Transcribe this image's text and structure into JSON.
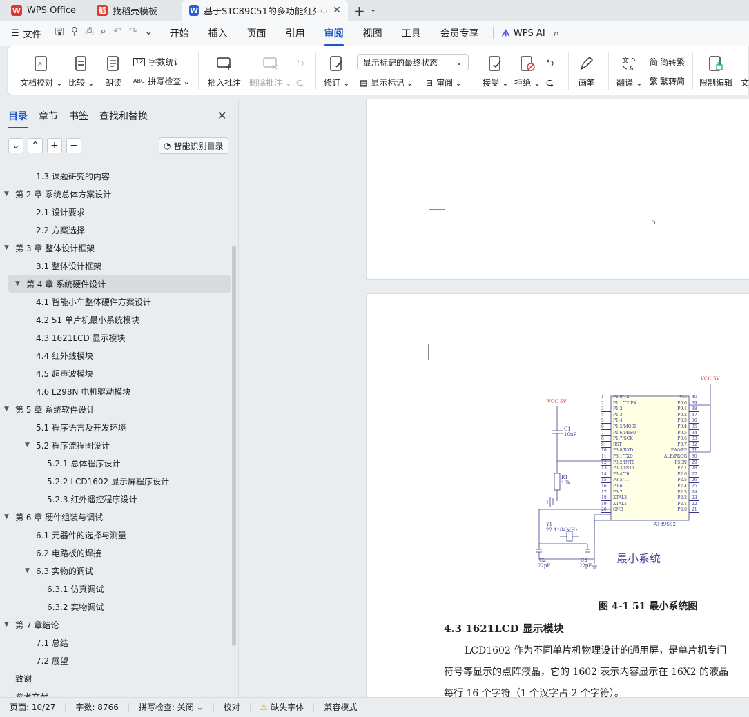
{
  "tabs": [
    {
      "label": "WPS Office",
      "color": "#e0362c"
    },
    {
      "label": "找稻壳模板",
      "color": "#e0362c"
    },
    {
      "label": "基于STC89C51的多功能红外遥",
      "color": "#2b5fd9"
    }
  ],
  "menu": {
    "file_label": "文件",
    "items": [
      "开始",
      "插入",
      "页面",
      "引用",
      "审阅",
      "视图",
      "工具",
      "会员专享"
    ],
    "active": "审阅",
    "wps_ai": "WPS AI"
  },
  "ribbon": {
    "doc_check": "文档校对",
    "compare": "比较",
    "read_aloud": "朗读",
    "word_count": "字数统计",
    "spell_check": "拼写检查",
    "insert_comment": "插入批注",
    "delete_comment": "删除批注",
    "track": "修订",
    "markup_state": "显示标记的最终状态",
    "show_markup": "显示标记",
    "review_pane": "审阅",
    "accept": "接受",
    "reject": "拒绝",
    "pen": "画笔",
    "translate": "翻译",
    "to_trad": "简转繁",
    "to_simp": "繁转简",
    "restrict": "限制编辑",
    "more": "文"
  },
  "sidebar": {
    "tabs": [
      "目录",
      "章节",
      "书签",
      "查找和替换"
    ],
    "smart_toc": "智能识别目录",
    "toc": [
      {
        "text": "1.3   课题研究的内容",
        "level": 2,
        "arrow": ""
      },
      {
        "text": "第 2 章  系统总体方案设计",
        "level": 1,
        "arrow": "▼"
      },
      {
        "text": "2.1  设计要求",
        "level": 2,
        "arrow": ""
      },
      {
        "text": "2.2  方案选择",
        "level": 2,
        "arrow": ""
      },
      {
        "text": "第 3 章  整体设计框架",
        "level": 1,
        "arrow": "▼"
      },
      {
        "text": "3.1  整体设计框架",
        "level": 2,
        "arrow": ""
      },
      {
        "text": "第 4 章  系统硬件设计",
        "level": 1,
        "arrow": "▼",
        "selected": true
      },
      {
        "text": "4.1  智能小车整体硬件方案设计",
        "level": 2,
        "arrow": ""
      },
      {
        "text": "4.2 51 单片机最小系统模块",
        "level": 2,
        "arrow": ""
      },
      {
        "text": "4.3 1621LCD 显示模块",
        "level": 2,
        "arrow": ""
      },
      {
        "text": "4.4  红外线模块",
        "level": 2,
        "arrow": ""
      },
      {
        "text": "4.5  超声波模块",
        "level": 2,
        "arrow": ""
      },
      {
        "text": "4.6 L298N 电机驱动模块",
        "level": 2,
        "arrow": ""
      },
      {
        "text": "第 5 章  系统软件设计",
        "level": 1,
        "arrow": "▼"
      },
      {
        "text": "5.1  程序语言及开发环境",
        "level": 2,
        "arrow": ""
      },
      {
        "text": "5.2  程序流程图设计",
        "level": 2,
        "arrow": "▼"
      },
      {
        "text": "5.2.1  总体程序设计",
        "level": 3,
        "arrow": ""
      },
      {
        "text": "5.2.2 LCD1602 显示屏程序设计",
        "level": 3,
        "arrow": ""
      },
      {
        "text": "5.2.3  红外遥控程序设计",
        "level": 3,
        "arrow": ""
      },
      {
        "text": "第 6 章  硬件组装与调试",
        "level": 1,
        "arrow": "▼"
      },
      {
        "text": "6.1  元器件的选择与测量",
        "level": 2,
        "arrow": ""
      },
      {
        "text": "6.2  电路板的焊接",
        "level": 2,
        "arrow": ""
      },
      {
        "text": "6.3  实物的调试",
        "level": 2,
        "arrow": "▼"
      },
      {
        "text": "6.3.1  仿真调试",
        "level": 3,
        "arrow": ""
      },
      {
        "text": "6.3.2  实物调试",
        "level": 3,
        "arrow": ""
      },
      {
        "text": "第 7 章结论",
        "level": 1,
        "arrow": "▼"
      },
      {
        "text": "7.1  总结",
        "level": 2,
        "arrow": ""
      },
      {
        "text": "7.2  展望",
        "level": 2,
        "arrow": ""
      },
      {
        "text": "致谢",
        "level": 1,
        "arrow": ""
      },
      {
        "text": "参考文献",
        "level": 1,
        "arrow": ""
      }
    ]
  },
  "document": {
    "page_number": "5",
    "schematic": {
      "vcc_top": "VCC 5V",
      "vcc_left": "VCC 5V",
      "c1": "C1",
      "c1_val": "10uF",
      "r1": "R1",
      "r1_val": "10k",
      "y1": "Y1",
      "y1_val": "22.1184MHz",
      "c2": "C2",
      "c2_val": "22pF",
      "c3": "C3",
      "c3_val": "22pF",
      "chip": "AT89S52",
      "caption_cn": "最小系统",
      "left_pins": [
        "P1.0/T2",
        "P1.1/T2 EX",
        "P1.2",
        "P1.3",
        "P1.4",
        "P1.5/MOSI",
        "P1.6/MISO",
        "P1.7/SCK",
        "RST",
        "P3.0/RXD",
        "P3.1/TXD",
        "P3.2/INT0",
        "P3.3/INT1",
        "P3.4/T0",
        "P3.5/T1",
        "P3.6",
        "P3.7",
        "XTAL2",
        "XTAL1",
        "GND"
      ],
      "right_pins": [
        "Vcc",
        "P0.0",
        "P0.1",
        "P0.2",
        "P0.3",
        "P0.4",
        "P0.5",
        "P0.6",
        "P0.7",
        "EA/VPP",
        "ALE/PROG",
        "PSEN",
        "P2.7",
        "P2.6",
        "P2.5",
        "P2.4",
        "P2.3",
        "P2.2",
        "P2.1",
        "P2.0"
      ]
    },
    "figure_caption": "图 4-1    51 最小系统图",
    "section_heading": "4.3 1621LCD 显示模块",
    "paragraph_lines": [
      "LCD1602 作为不同单片机物理设计的通用屏，是单片机专门",
      "符号等显示的点阵液晶，它的 1602 表示内容显示在 16X2 的液晶",
      "每行 16 个字符（1 个汉字占 2 个字符）。"
    ]
  },
  "status": {
    "page": "页面: 10/27",
    "words": "字数: 8766",
    "spell": "拼写检查: 关闭",
    "proof": "校对",
    "missing_font": "缺失字体",
    "compat": "兼容模式"
  }
}
